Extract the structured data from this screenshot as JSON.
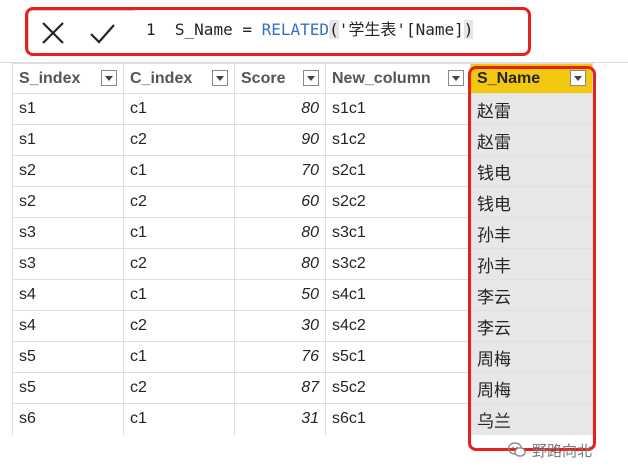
{
  "formula": {
    "line_number": "1",
    "column_name": "S_Name",
    "operator": "=",
    "function": "RELATED",
    "open_paren": "(",
    "table_ref": "'学生表'",
    "column_ref": "[Name]",
    "close_paren": ")"
  },
  "table": {
    "columns": [
      "S_index",
      "C_index",
      "Score",
      "New_column",
      "S_Name"
    ],
    "selected_column": "S_Name",
    "rows": [
      [
        "s1",
        "c1",
        "80",
        "s1c1",
        "赵雷"
      ],
      [
        "s1",
        "c2",
        "90",
        "s1c2",
        "赵雷"
      ],
      [
        "s2",
        "c1",
        "70",
        "s2c1",
        "钱电"
      ],
      [
        "s2",
        "c2",
        "60",
        "s2c2",
        "钱电"
      ],
      [
        "s3",
        "c1",
        "80",
        "s3c1",
        "孙丰"
      ],
      [
        "s3",
        "c2",
        "80",
        "s3c2",
        "孙丰"
      ],
      [
        "s4",
        "c1",
        "50",
        "s4c1",
        "李云"
      ],
      [
        "s4",
        "c2",
        "30",
        "s4c2",
        "李云"
      ],
      [
        "s5",
        "c1",
        "76",
        "s5c1",
        "周梅"
      ],
      [
        "s5",
        "c2",
        "87",
        "s5c2",
        "周梅"
      ],
      [
        "s6",
        "c1",
        "31",
        "s6c1",
        "乌兰"
      ]
    ]
  },
  "colors": {
    "selected_header": "#f2c811",
    "selected_column_bg": "#e7e7e7",
    "annotation_red": "#e8201c",
    "function_blue": "#3a6fc4"
  },
  "icons": {
    "cancel": "x-icon",
    "commit": "check-icon",
    "filter": "filter-dropdown-icon",
    "watermark": "wechat-icon"
  },
  "watermark": {
    "text": "野路向北"
  }
}
